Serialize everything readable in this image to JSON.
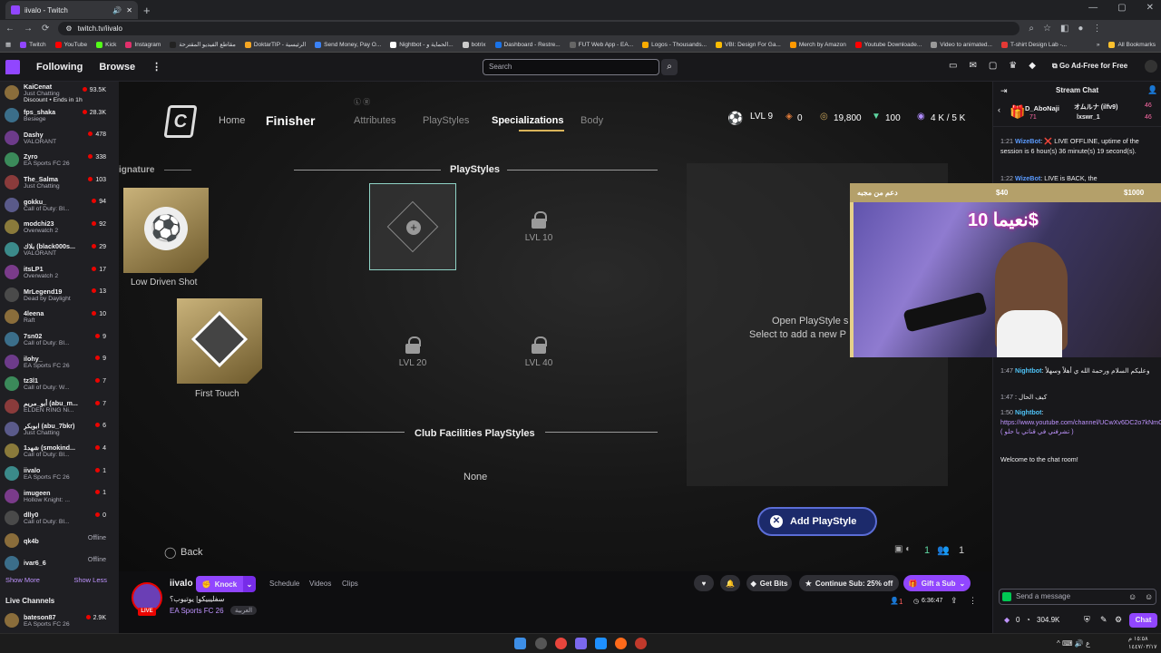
{
  "browser": {
    "tab_title": "iivalo - Twitch",
    "url": "twitch.tv/iivalo",
    "all_bookmarks": "All Bookmarks",
    "bookmarks": [
      "Twitch",
      "YouTube",
      "Kick",
      "Instagram",
      "مقاطع الفيديو المقترحة",
      "DoktarTIP - الرئيسية",
      "Send Money, Pay O...",
      "Nightbot - الحماية و...",
      "botrix",
      "Dashboard - Restre...",
      "FUT Web App - EA...",
      "Logos - Thousands...",
      "VBI: Design For Ga...",
      "Merch by Amazon",
      "Youtube Downloade...",
      "Video to animated...",
      "T-shirt Design Lab -..."
    ]
  },
  "nav": {
    "following": "Following",
    "browse": "Browse",
    "search_placeholder": "Search",
    "ad_free": "Go Ad-Free for Free"
  },
  "sidebar": {
    "channels": [
      {
        "name": "KaiCenat",
        "game": "Just Chatting",
        "viewers": "93.5K",
        "extra": "Discount • Ends in 1h"
      },
      {
        "name": "fps_shaka",
        "game": "Besiege",
        "viewers": "28.3K"
      },
      {
        "name": "Dashy",
        "game": "VALORANT",
        "viewers": "478"
      },
      {
        "name": "Zyro",
        "game": "EA Sports FC 26",
        "viewers": "338"
      },
      {
        "name": "The_Salma",
        "game": "Just Chatting",
        "viewers": "103"
      },
      {
        "name": "gokku_",
        "game": "Call of Duty: Bl...",
        "viewers": "94"
      },
      {
        "name": "modchi23",
        "game": "Overwatch 2",
        "viewers": "92"
      },
      {
        "name": "بلاك (black000s...",
        "game": "VALORANT",
        "viewers": "29"
      },
      {
        "name": "itsLP1",
        "game": "Overwatch 2",
        "viewers": "17"
      },
      {
        "name": "MrLegend19",
        "game": "Dead by Daylight",
        "viewers": "13"
      },
      {
        "name": "4leena",
        "game": "Raft",
        "viewers": "10"
      },
      {
        "name": "7sn02",
        "game": "Call of Duty: Bl...",
        "viewers": "9"
      },
      {
        "name": "ilohy_",
        "game": "EA Sports FC 26",
        "viewers": "9"
      },
      {
        "name": "tz3l1",
        "game": "Call of Duty: W...",
        "viewers": "7"
      },
      {
        "name": "أبو_مريم (abu_m...",
        "game": "ELDEN RING Ni...",
        "viewers": "7"
      },
      {
        "name": "ابوبكر (abu_7bkr)",
        "game": "Just Chatting",
        "viewers": "6"
      },
      {
        "name": "شهد1 (smokind...",
        "game": "Call of Duty: Bl...",
        "viewers": "4"
      },
      {
        "name": "iivalo",
        "game": "EA Sports FC 26",
        "viewers": "1"
      },
      {
        "name": "imugeen",
        "game": "Hollow Knight: ...",
        "viewers": "1"
      },
      {
        "name": "dlly0",
        "game": "Call of Duty: Bl...",
        "viewers": "0"
      },
      {
        "name": "qk4b",
        "game": "",
        "viewers": "Offline"
      },
      {
        "name": "ivar6_6",
        "game": "",
        "viewers": "Offline"
      }
    ],
    "show_more": "Show More",
    "show_less": "Show Less",
    "live_channels": "Live Channels",
    "live": {
      "name": "bateson87",
      "game": "EA Sports FC 26",
      "viewers": "2.9K"
    }
  },
  "game": {
    "signature": "ignature",
    "tabs": [
      "Home",
      "Finisher",
      "Attributes",
      "PlayStyles",
      "Specializations",
      "Body"
    ],
    "level": "LVL 9",
    "points": "0",
    "coins": "19,800",
    "gems": "100",
    "sp": "4 K / 5 K",
    "playstyles_heading": "PlayStyles",
    "club_heading": "Club Facilities PlayStyles",
    "none": "None",
    "low_driven_shot": "Low Driven Shot",
    "first_touch": "First Touch",
    "lvl10": "LVL 10",
    "lvl20": "LVL 20",
    "lvl40": "LVL 40",
    "open_ps": "Open PlayStyle s",
    "select_add": "Select to add a new P",
    "add_playstyle": "Add PlayStyle",
    "back": "Back",
    "count1": "1",
    "count2": "1"
  },
  "chat": {
    "title": "Stream Chat",
    "top_users": [
      {
        "name": "D_AboNaji",
        "val": "71"
      },
      {
        "name": "オムルナ (ilfv9)",
        "val": "46"
      },
      {
        "name": "lxswr_1",
        "val": "46"
      }
    ],
    "messages": [
      {
        "time": "1:21",
        "name": "WizeBot",
        "text": "❌ LIVE OFFLINE, uptime of the session is 6 hour(s) 36 minute(s) 19 second(s)."
      },
      {
        "time": "1:22",
        "name": "WizeBot",
        "text": "LIVE is BACK, the"
      },
      {
        "time": "1:47",
        "name": "Nightbot",
        "text": "وعليكم السلام ورحمة الله ي أهلاً وسهلاً"
      },
      {
        "time": "1:47",
        "name": "",
        "text": "كيف الحال"
      },
      {
        "time": "1:50",
        "name": "Nightbot",
        "text": "https://www.youtube.com/channel/UCwXv6DC2o7kNmGVxmNPhRJA ( تشرفني في قناتي يا حلو )"
      }
    ],
    "welcome": "Welcome to the chat room!",
    "send_placeholder": "Send a message",
    "points": "0",
    "balance": "304.9K",
    "chat_button": "Chat"
  },
  "overlay": {
    "donate_label": "دعم من مجبه",
    "amount1": "$40",
    "amount2": "$1000",
    "big_text": "نعيما 10$"
  },
  "stream": {
    "channel": "iivalo",
    "knock": "Knock",
    "links": [
      "Schedule",
      "Videos",
      "Clips"
    ],
    "title": "سفليبيكو| يوتيوب؟",
    "game": "EA Sports FC 26",
    "lang_tag": "العربية",
    "live": "LIVE",
    "get_bits": "Get Bits",
    "continue_sub": "Continue Sub: 25% off",
    "gift_sub": "Gift a Sub",
    "viewer_count": "1",
    "uptime": "6:36:47"
  },
  "taskbar": {
    "time": "١٥:٥٨ م",
    "date": "١٤٤٧/٠٣/١٧"
  }
}
